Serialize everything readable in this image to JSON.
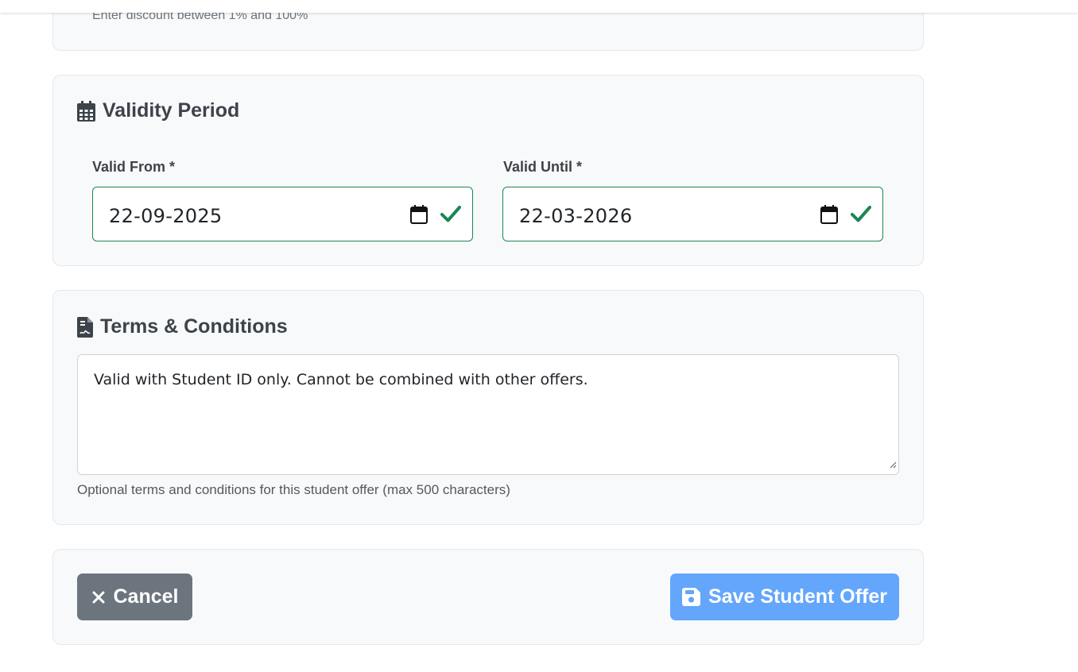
{
  "discount_section": {
    "help_text": "Enter discount between 1% and 100%"
  },
  "validity": {
    "title": "Validity Period",
    "icon": "calendar-icon",
    "valid_from": {
      "label": "Valid From *",
      "value": "22-09-2025",
      "status": "valid"
    },
    "valid_until": {
      "label": "Valid Until *",
      "value": "22-03-2026",
      "status": "valid"
    }
  },
  "terms": {
    "title": "Terms & Conditions",
    "icon": "document-icon",
    "value": "Valid with Student ID only. Cannot be combined with other offers.",
    "help": "Optional terms and conditions for this student offer (max 500 characters)"
  },
  "actions": {
    "cancel_label": "Cancel",
    "save_label": "Save Student Offer"
  },
  "colors": {
    "valid_border": "#198754",
    "cancel_bg": "#6c757d",
    "save_bg": "#63a6fb",
    "card_bg": "#f8f9fa"
  }
}
